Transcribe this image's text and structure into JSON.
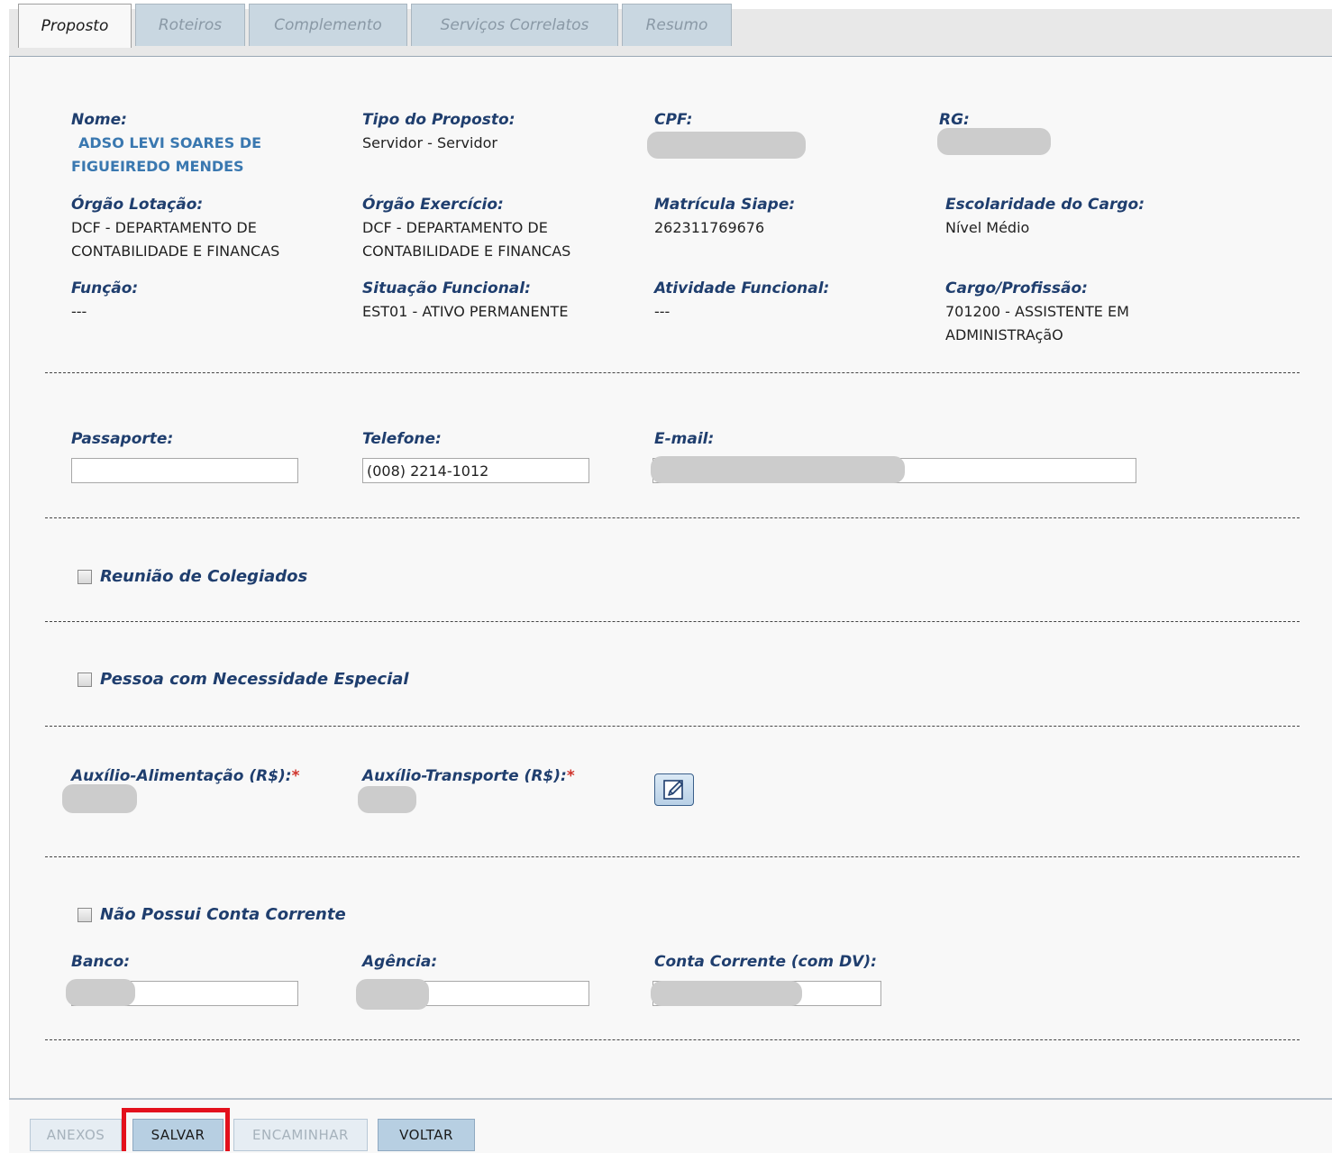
{
  "tabs": [
    {
      "label": "Proposto",
      "active": true
    },
    {
      "label": "Roteiros",
      "active": false
    },
    {
      "label": "Complemento",
      "active": false
    },
    {
      "label": "Serviços Correlatos",
      "active": false
    },
    {
      "label": "Resumo",
      "active": false
    }
  ],
  "proposto": {
    "nome_label": "Nome:",
    "nome_line1": "ADSO LEVI SOARES DE",
    "nome_line2": "FIGUEIREDO MENDES",
    "tipo_label": "Tipo do Proposto:",
    "tipo_value": "Servidor - Servidor",
    "cpf_label": "CPF:",
    "rg_label": "RG:",
    "orgao_lotacao_label": "Órgão Lotação:",
    "orgao_lotacao_line1": "DCF - DEPARTAMENTO DE",
    "orgao_lotacao_line2": "CONTABILIDADE E FINANCAS",
    "orgao_exercicio_label": "Órgão Exercício:",
    "orgao_exercicio_line1": "DCF - DEPARTAMENTO DE",
    "orgao_exercicio_line2": "CONTABILIDADE E FINANCAS",
    "matricula_label": "Matrícula Siape:",
    "matricula_value": "262311769676",
    "escolaridade_label": "Escolaridade do Cargo:",
    "escolaridade_value": "Nível Médio",
    "funcao_label": "Função:",
    "funcao_value": "---",
    "situacao_label": "Situação Funcional:",
    "situacao_value": "EST01 - ATIVO PERMANENTE",
    "atividade_label": "Atividade Funcional:",
    "atividade_value": "---",
    "cargo_label": "Cargo/Profissão:",
    "cargo_line1": "701200 - ASSISTENTE EM",
    "cargo_line2": "ADMINISTRAçãO"
  },
  "contato": {
    "passaporte_label": "Passaporte:",
    "passaporte_value": "",
    "telefone_label": "Telefone:",
    "telefone_value": "(008) 2214-1012",
    "email_label": "E-mail:"
  },
  "checkboxes": {
    "reuniao": "Reunião de Colegiados",
    "necessidade": "Pessoa com Necessidade Especial",
    "sem_conta": "Não Possui Conta Corrente"
  },
  "auxilios": {
    "alimentacao_label": "Auxílio-Alimentação (R$):",
    "transporte_label": "Auxílio-Transporte (R$):",
    "required_mark": "*"
  },
  "banco": {
    "banco_label": "Banco:",
    "agencia_label": "Agência:",
    "conta_label": "Conta Corrente (com DV):"
  },
  "buttons": {
    "anexos": "ANEXOS",
    "salvar": "SALVAR",
    "encaminhar": "ENCAMINHAR",
    "voltar": "VOLTAR"
  },
  "icons": {
    "edit": "edit-pencil-icon"
  },
  "colors": {
    "label": "#1f3e6e",
    "name_value": "#3a78b0",
    "required": "#d0342c",
    "highlight": "#e3101c",
    "tab_inactive": "#c9d7e1",
    "button_enabled": "#b7cfe2"
  }
}
